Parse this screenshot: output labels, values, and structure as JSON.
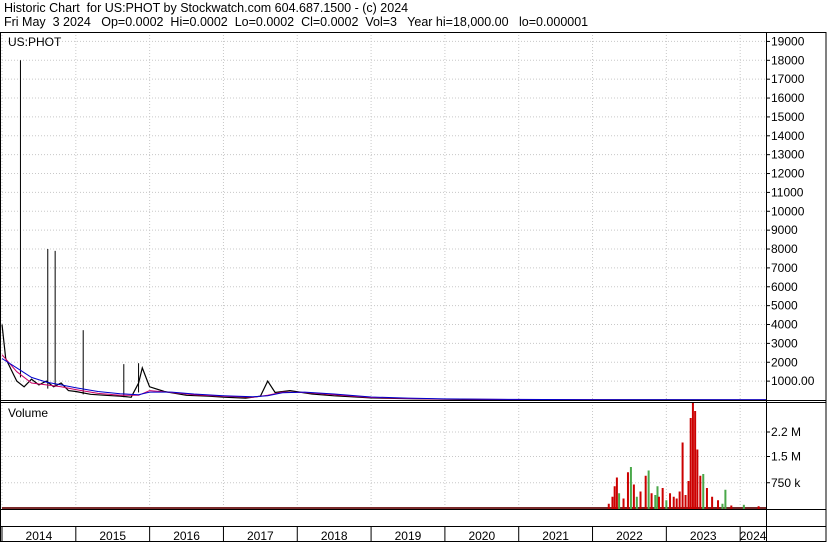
{
  "header": {
    "line1": "Historic Chart  for US:PHOT by Stockwatch.com 604.687.1500 - (c) 2024",
    "line2": "Fri May  3 2024   Op=0.0002  Hi=0.0002  Lo=0.0002  Cl=0.0002  Vol=3   Year hi=18,000.00   lo=0.000001"
  },
  "chart_data": [
    {
      "type": "line",
      "title": "US:PHOT",
      "ylim": [
        0,
        19500
      ],
      "y_ticks": [
        1000,
        2000,
        3000,
        4000,
        5000,
        6000,
        7000,
        8000,
        9000,
        10000,
        11000,
        12000,
        13000,
        14000,
        15000,
        16000,
        17000,
        18000,
        19000
      ],
      "y_tick_labels": [
        "1000.00",
        "2000",
        "3000",
        "4000",
        "5000",
        "6000",
        "7000",
        "8000",
        "9000",
        "10000",
        "11000",
        "12000",
        "13000",
        "14000",
        "15000",
        "16000",
        "17000",
        "18000",
        "19000"
      ],
      "x_labels": [
        "2014",
        "2015",
        "2016",
        "2017",
        "2018",
        "2019",
        "2020",
        "2021",
        "2022",
        "2023",
        "2024"
      ],
      "grid": true,
      "spikes": [
        {
          "x": 2014.25,
          "high": 18000,
          "low": 1200
        },
        {
          "x": 2014.62,
          "high": 8000,
          "low": 600
        },
        {
          "x": 2014.72,
          "high": 7900,
          "low": 700
        },
        {
          "x": 2015.1,
          "high": 3700,
          "low": 300
        },
        {
          "x": 2015.65,
          "high": 1900,
          "low": 150
        },
        {
          "x": 2015.85,
          "high": 1950,
          "low": 400
        }
      ],
      "series": [
        {
          "color": "#000000",
          "x": [
            2014.0,
            2014.05,
            2014.1,
            2014.15,
            2014.2,
            2014.3,
            2014.4,
            2014.5,
            2014.6,
            2014.7,
            2014.8,
            2014.9,
            2015.0,
            2015.2,
            2015.4,
            2015.6,
            2015.75,
            2015.85,
            2015.9,
            2016.0,
            2016.2,
            2016.5,
            2016.8,
            2017.0,
            2017.3,
            2017.5,
            2017.6,
            2017.7,
            2017.9,
            2018.2,
            2018.5,
            2018.8,
            2019.0,
            2019.5,
            2020.0,
            2020.5,
            2021.0,
            2022.0,
            2023.0,
            2024.0,
            2024.35
          ],
          "values": [
            4000,
            2200,
            1800,
            1400,
            1000,
            700,
            1100,
            800,
            1000,
            700,
            900,
            500,
            450,
            300,
            250,
            200,
            150,
            900,
            1700,
            700,
            450,
            250,
            200,
            150,
            100,
            200,
            1000,
            400,
            500,
            320,
            220,
            160,
            110,
            70,
            40,
            20,
            10,
            5,
            3,
            1,
            0.0002
          ]
        },
        {
          "color": "#cc0066",
          "x": [
            2014.0,
            2014.2,
            2014.4,
            2014.6,
            2014.8,
            2015.0,
            2015.3,
            2015.6,
            2015.85,
            2016.0,
            2016.3,
            2016.6,
            2017.0,
            2017.4,
            2017.6,
            2017.8,
            2018.1,
            2018.5,
            2019.0,
            2019.5,
            2020.0,
            2021.0,
            2022.0,
            2024.35
          ],
          "values": [
            2400,
            1500,
            900,
            800,
            700,
            550,
            350,
            250,
            250,
            500,
            400,
            280,
            200,
            150,
            250,
            420,
            400,
            280,
            130,
            80,
            50,
            20,
            10,
            5
          ]
        },
        {
          "color": "#0000cc",
          "x": [
            2014.0,
            2014.2,
            2014.4,
            2014.6,
            2014.8,
            2015.0,
            2015.3,
            2015.6,
            2015.85,
            2016.0,
            2016.3,
            2016.6,
            2017.0,
            2017.4,
            2017.6,
            2017.8,
            2018.1,
            2018.5,
            2019.0,
            2019.5,
            2020.0,
            2021.0,
            2022.0,
            2024.35
          ],
          "values": [
            2200,
            1700,
            1200,
            950,
            800,
            650,
            450,
            330,
            280,
            420,
            420,
            320,
            230,
            170,
            220,
            380,
            420,
            320,
            160,
            100,
            60,
            30,
            15,
            8
          ]
        }
      ]
    },
    {
      "type": "bar",
      "title": "Volume",
      "ylim": [
        0,
        3000000
      ],
      "y_ticks": [
        750000,
        1500000,
        2200000
      ],
      "y_tick_labels": [
        "750 k",
        "1.5 M",
        "2.2 M"
      ],
      "bars": [
        {
          "x": 2022.22,
          "value": 150000,
          "color": "#cc0000"
        },
        {
          "x": 2022.27,
          "value": 350000,
          "color": "#cc0000"
        },
        {
          "x": 2022.3,
          "value": 650000,
          "color": "#cc0000"
        },
        {
          "x": 2022.33,
          "value": 900000,
          "color": "#cc0000"
        },
        {
          "x": 2022.36,
          "value": 450000,
          "color": "#4aa84a"
        },
        {
          "x": 2022.42,
          "value": 300000,
          "color": "#cc0000"
        },
        {
          "x": 2022.48,
          "value": 1050000,
          "color": "#cc0000"
        },
        {
          "x": 2022.52,
          "value": 1200000,
          "color": "#4aa84a"
        },
        {
          "x": 2022.56,
          "value": 700000,
          "color": "#cc0000"
        },
        {
          "x": 2022.6,
          "value": 350000,
          "color": "#4aa84a"
        },
        {
          "x": 2022.65,
          "value": 500000,
          "color": "#cc0000"
        },
        {
          "x": 2022.72,
          "value": 950000,
          "color": "#cc0000"
        },
        {
          "x": 2022.76,
          "value": 1100000,
          "color": "#4aa84a"
        },
        {
          "x": 2022.8,
          "value": 450000,
          "color": "#cc0000"
        },
        {
          "x": 2022.85,
          "value": 400000,
          "color": "#4aa84a"
        },
        {
          "x": 2022.88,
          "value": 650000,
          "color": "#4aa84a"
        },
        {
          "x": 2022.9,
          "value": 350000,
          "color": "#cc0000"
        },
        {
          "x": 2022.95,
          "value": 600000,
          "color": "#cc0000"
        },
        {
          "x": 2023.0,
          "value": 250000,
          "color": "#4aa84a"
        },
        {
          "x": 2023.05,
          "value": 450000,
          "color": "#cc0000"
        },
        {
          "x": 2023.1,
          "value": 350000,
          "color": "#cc0000"
        },
        {
          "x": 2023.14,
          "value": 300000,
          "color": "#cc0000"
        },
        {
          "x": 2023.18,
          "value": 500000,
          "color": "#cc0000"
        },
        {
          "x": 2023.22,
          "value": 1900000,
          "color": "#cc0000"
        },
        {
          "x": 2023.26,
          "value": 400000,
          "color": "#cc0000"
        },
        {
          "x": 2023.3,
          "value": 800000,
          "color": "#cc0000"
        },
        {
          "x": 2023.33,
          "value": 2600000,
          "color": "#cc0000"
        },
        {
          "x": 2023.36,
          "value": 3050000,
          "color": "#cc0000"
        },
        {
          "x": 2023.39,
          "value": 2800000,
          "color": "#cc0000"
        },
        {
          "x": 2023.42,
          "value": 1700000,
          "color": "#cc0000"
        },
        {
          "x": 2023.46,
          "value": 950000,
          "color": "#cc0000"
        },
        {
          "x": 2023.5,
          "value": 1000000,
          "color": "#4aa84a"
        },
        {
          "x": 2023.55,
          "value": 600000,
          "color": "#cc0000"
        },
        {
          "x": 2023.62,
          "value": 350000,
          "color": "#cc0000"
        },
        {
          "x": 2023.7,
          "value": 250000,
          "color": "#cc0000"
        },
        {
          "x": 2023.76,
          "value": 150000,
          "color": "#4aa84a"
        },
        {
          "x": 2023.8,
          "value": 550000,
          "color": "#4aa84a"
        },
        {
          "x": 2023.88,
          "value": 100000,
          "color": "#cc0000"
        },
        {
          "x": 2024.05,
          "value": 120000,
          "color": "#4aa84a"
        },
        {
          "x": 2024.25,
          "value": 80000,
          "color": "#cc0000"
        }
      ]
    }
  ]
}
